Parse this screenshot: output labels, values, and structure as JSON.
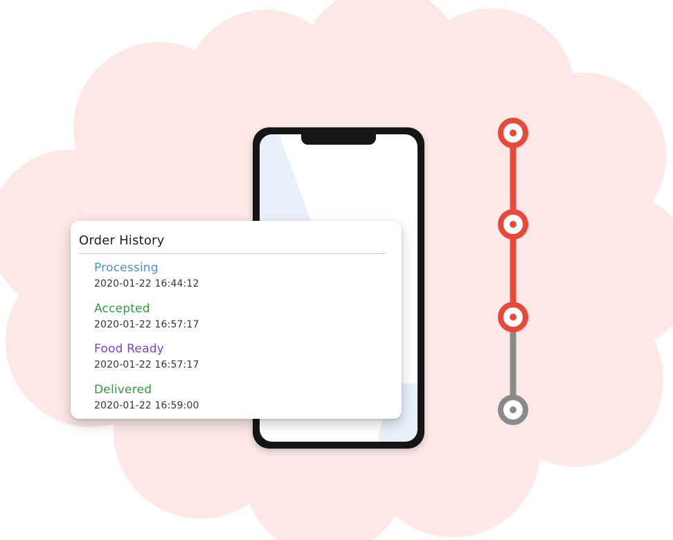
{
  "order_history": {
    "title": "Order History",
    "items": [
      {
        "status": "Processing",
        "timestamp": "2020-01-22 16:44:12",
        "color": "#4a90d9"
      },
      {
        "status": "Accepted",
        "timestamp": "2020-01-22 16:57:17",
        "color": "#2f9a3f"
      },
      {
        "status": "Food Ready",
        "timestamp": "2020-01-22 16:57:17",
        "color": "#7a45d8"
      },
      {
        "status": "Delivered",
        "timestamp": "2020-01-22 16:59:00",
        "color": "#2f9a3f"
      }
    ]
  },
  "timeline": {
    "steps": [
      {
        "state": "completed",
        "color": "#e84a3a"
      },
      {
        "state": "completed",
        "color": "#e84a3a"
      },
      {
        "state": "completed",
        "color": "#e84a3a"
      },
      {
        "state": "pending",
        "color": "#8a8a8a"
      }
    ]
  },
  "theme": {
    "cloud_background": "#fde8e6",
    "phone_frame": "#151515",
    "phone_screen": "#ffffff",
    "screen_accent": "#e8f0fb",
    "card_background": "#ffffff",
    "divider": "#c6c6c6",
    "timeline_active": "#e84a3a",
    "timeline_inactive": "#8a8a8a"
  },
  "icons": {
    "phone": "smartphone-icon",
    "timeline_step": "status-dot-icon"
  }
}
